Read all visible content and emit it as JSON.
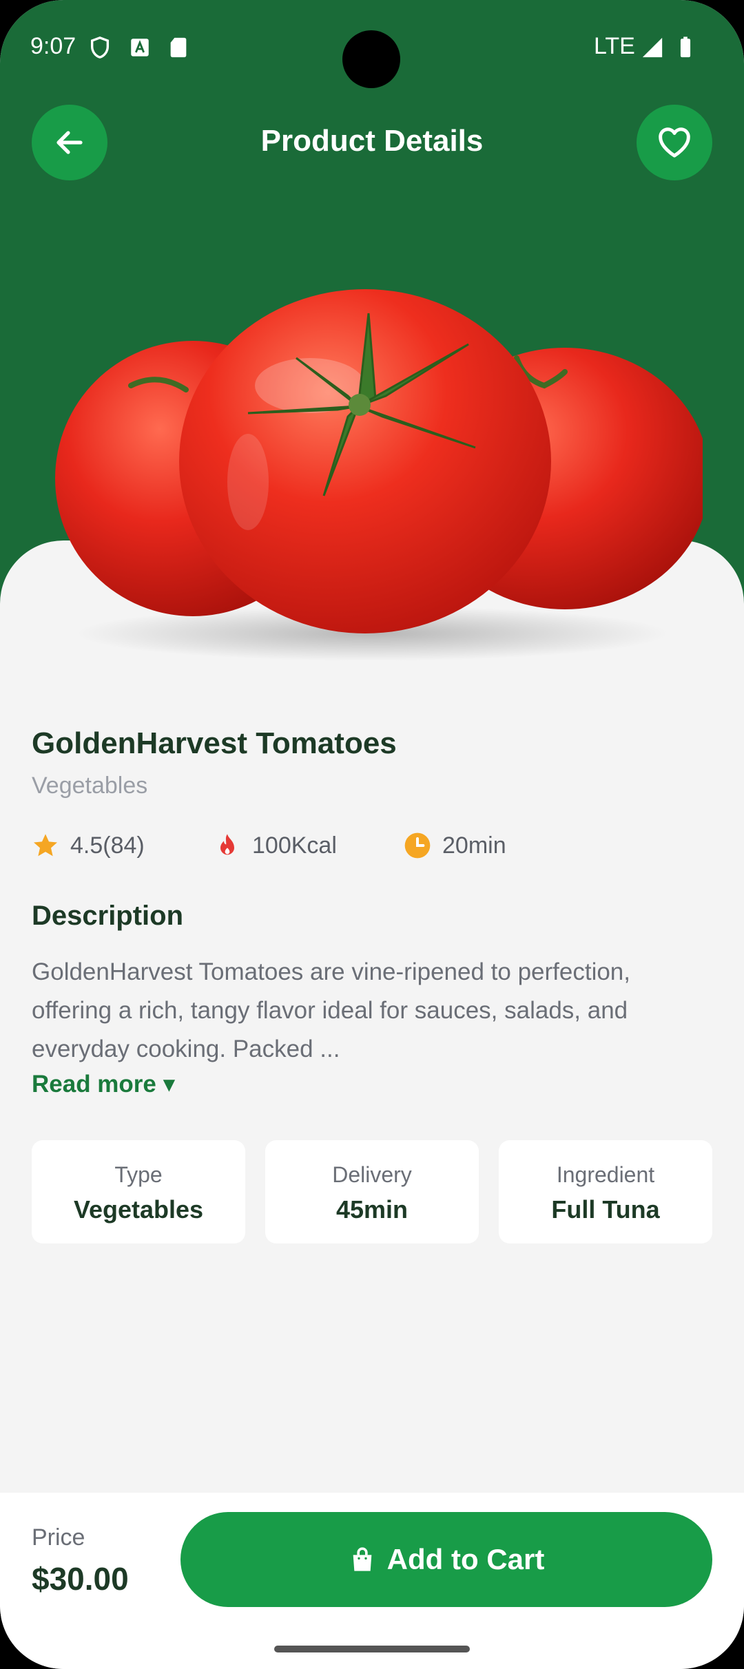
{
  "status_bar": {
    "time": "9:07",
    "network": "LTE"
  },
  "header": {
    "title": "Product Details"
  },
  "product": {
    "name": "GoldenHarvest Tomatoes",
    "category": "Vegetables",
    "rating": "4.5(84)",
    "calories": "100Kcal",
    "time": "20min"
  },
  "description": {
    "title": "Description",
    "text": "GoldenHarvest Tomatoes are vine-ripened to perfection, offering a rich, tangy flavor ideal for sauces, salads, and everyday cooking. Packed ...",
    "read_more": "Read more ▾"
  },
  "info_cards": [
    {
      "label": "Type",
      "value": "Vegetables"
    },
    {
      "label": "Delivery",
      "value": "45min"
    },
    {
      "label": "Ingredient",
      "value": "Full Tuna"
    }
  ],
  "footer": {
    "price_label": "Price",
    "price": "$30.00",
    "cart_label": "Add to Cart"
  },
  "colors": {
    "hero_green": "#1a6b38",
    "accent_green": "#189c48",
    "star": "#f5a623",
    "flame": "#e53935",
    "clock": "#f5a623"
  }
}
